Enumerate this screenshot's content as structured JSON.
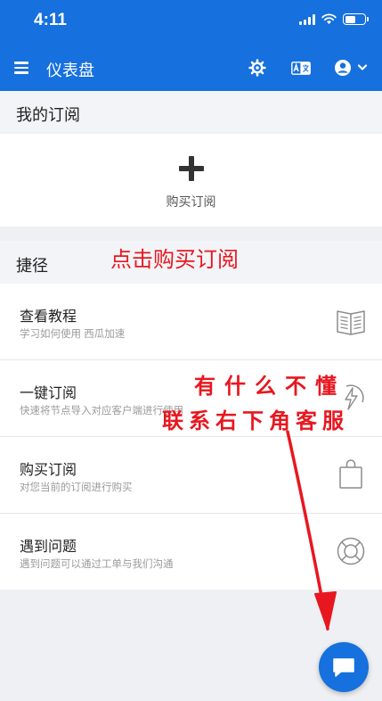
{
  "status_bar": {
    "time": "4:11"
  },
  "header": {
    "title": "仪表盘"
  },
  "subscriptions": {
    "section_title": "我的订阅",
    "buy_label": "购买订阅"
  },
  "shortcuts": {
    "section_title": "捷径",
    "items": [
      {
        "title": "查看教程",
        "subtitle": "学习如何使用 西瓜加速",
        "icon": "book-icon"
      },
      {
        "title": "一键订阅",
        "subtitle": "快速将节点导入对应客户端进行使用",
        "icon": "lightning-icon"
      },
      {
        "title": "购买订阅",
        "subtitle": "对您当前的订阅进行购买",
        "icon": "shopping-bag-icon"
      },
      {
        "title": "遇到问题",
        "subtitle": "遇到问题可以通过工单与我们沟通",
        "icon": "lifebuoy-icon"
      }
    ]
  },
  "annotations": {
    "top": "点击购买订阅",
    "line1": "有什么不懂",
    "line2": "联系右下角客服"
  },
  "colors": {
    "primary": "#1670dd",
    "annotation": "#e8171f"
  }
}
